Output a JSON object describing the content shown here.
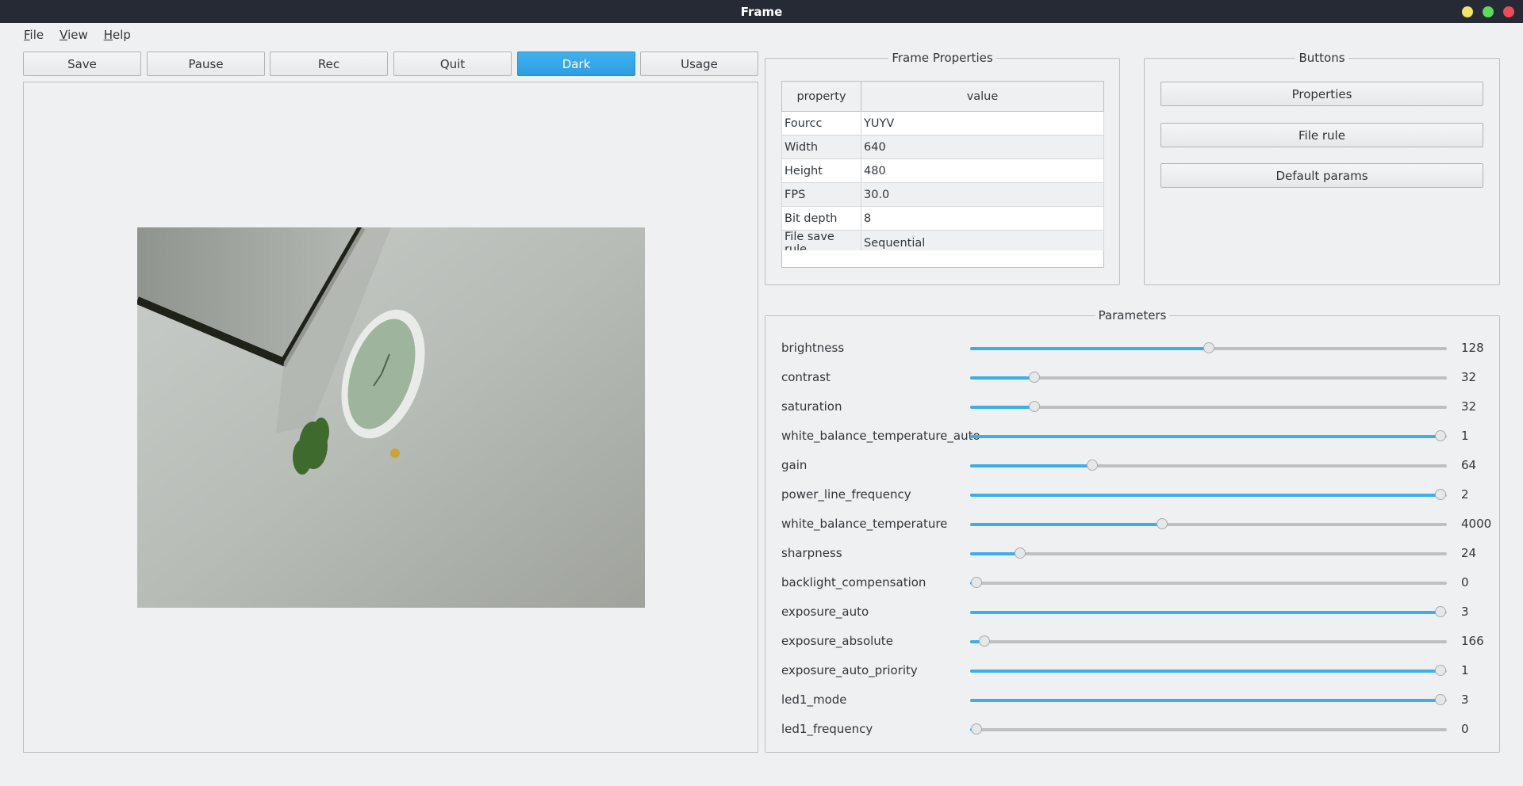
{
  "window": {
    "title": "Frame"
  },
  "menu": [
    "File",
    "View",
    "Help"
  ],
  "toolbar": [
    {
      "label": "Save",
      "active": false
    },
    {
      "label": "Pause",
      "active": false
    },
    {
      "label": "Rec",
      "active": false
    },
    {
      "label": "Quit",
      "active": false
    },
    {
      "label": "Dark",
      "active": true
    },
    {
      "label": "Usage",
      "active": false
    }
  ],
  "frame_properties": {
    "title": "Frame Properties",
    "headers": [
      "property",
      "value"
    ],
    "rows": [
      [
        "Fourcc",
        "YUYV"
      ],
      [
        "Width",
        "640"
      ],
      [
        "Height",
        "480"
      ],
      [
        "FPS",
        "30.0"
      ],
      [
        "Bit depth",
        "8"
      ],
      [
        "File save rule",
        "Sequential"
      ]
    ]
  },
  "buttons_group": {
    "title": "Buttons",
    "items": [
      "Properties",
      "File rule",
      "Default params"
    ]
  },
  "parameters": {
    "title": "Parameters",
    "items": [
      {
        "name": "brightness",
        "value": "128",
        "level": 0.5
      },
      {
        "name": "contrast",
        "value": "32",
        "level": 0.125
      },
      {
        "name": "saturation",
        "value": "32",
        "level": 0.125
      },
      {
        "name": "white_balance_temperature_auto",
        "value": "1",
        "level": 1.0
      },
      {
        "name": "gain",
        "value": "64",
        "level": 0.25
      },
      {
        "name": "power_line_frequency",
        "value": "2",
        "level": 1.0
      },
      {
        "name": "white_balance_temperature",
        "value": "4000",
        "level": 0.4
      },
      {
        "name": "sharpness",
        "value": "24",
        "level": 0.094
      },
      {
        "name": "backlight_compensation",
        "value": "0",
        "level": 0.0
      },
      {
        "name": "exposure_auto",
        "value": "3",
        "level": 1.0
      },
      {
        "name": "exposure_absolute",
        "value": "166",
        "level": 0.017
      },
      {
        "name": "exposure_auto_priority",
        "value": "1",
        "level": 1.0
      },
      {
        "name": "led1_mode",
        "value": "3",
        "level": 1.0
      },
      {
        "name": "led1_frequency",
        "value": "0",
        "level": 0.0
      }
    ]
  },
  "colors": {
    "accent": "#3daee9",
    "titlebar": "#252a35",
    "background": "#eff0f1"
  }
}
